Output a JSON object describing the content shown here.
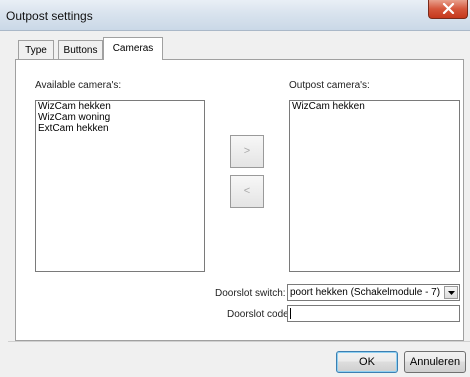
{
  "window": {
    "title": "Outpost settings"
  },
  "tabs": [
    {
      "label": "Type"
    },
    {
      "label": "Buttons"
    },
    {
      "label": "Cameras"
    }
  ],
  "cameras": {
    "available_label": "Available camera's:",
    "outpost_label": "Outpost camera's:",
    "available_items": [
      "WizCam hekken",
      "WizCam woning",
      "ExtCam hekken"
    ],
    "outpost_items": [
      "WizCam hekken"
    ],
    "add_label": ">",
    "remove_label": "<"
  },
  "doorslot": {
    "switch_label": "Doorslot switch:",
    "switch_value": "poort hekken (Schakelmodule - 7)",
    "code_label": "Doorslot code:",
    "code_value": ""
  },
  "footer": {
    "ok_label": "OK",
    "cancel_label": "Annuleren"
  }
}
